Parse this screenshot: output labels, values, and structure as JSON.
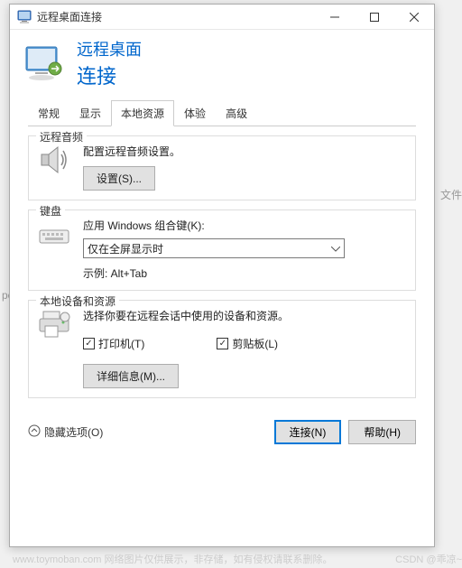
{
  "bg": {
    "left": "pc",
    "right": "文件"
  },
  "titlebar": {
    "title": "远程桌面连接"
  },
  "header": {
    "line1": "远程桌面",
    "line2": "连接"
  },
  "tabs": [
    {
      "label": "常规"
    },
    {
      "label": "显示"
    },
    {
      "label": "本地资源"
    },
    {
      "label": "体验"
    },
    {
      "label": "高级"
    }
  ],
  "active_tab": 2,
  "audio": {
    "title": "远程音频",
    "desc": "配置远程音频设置。",
    "settings_btn": "设置(S)..."
  },
  "keyboard": {
    "title": "键盘",
    "desc": "应用 Windows 组合键(K):",
    "selected": "仅在全屏显示时",
    "example": "示例: Alt+Tab"
  },
  "devices": {
    "title": "本地设备和资源",
    "desc": "选择你要在远程会话中使用的设备和资源。",
    "printer": "打印机(T)",
    "clipboard": "剪贴板(L)",
    "details_btn": "详细信息(M)..."
  },
  "footer": {
    "hide_options": "隐藏选项(O)",
    "connect": "连接(N)",
    "help": "帮助(H)"
  },
  "watermark": {
    "left": "www.toymoban.com 网络图片仅供展示，非存储，如有侵权请联系删除。",
    "right": "CSDN @乖凉~"
  }
}
